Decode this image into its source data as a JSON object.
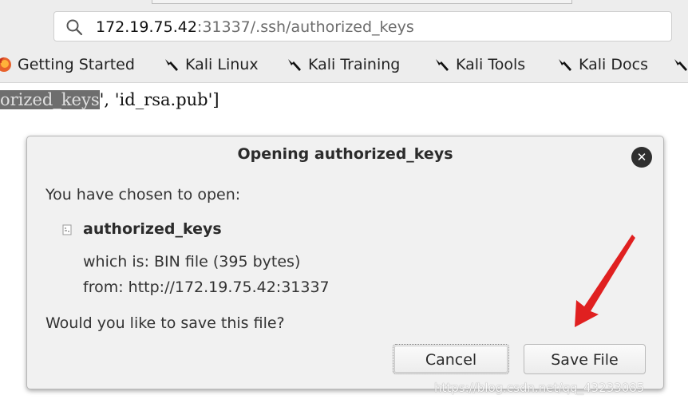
{
  "browser": {
    "url_host": "172.19.75.42",
    "url_rest": ":31337/.ssh/authorized_keys",
    "bookmarks": [
      {
        "label": "Getting Started",
        "icon": "firefox-icon"
      },
      {
        "label": "Kali Linux",
        "icon": "kali-dragon-icon"
      },
      {
        "label": "Kali Training",
        "icon": "kali-dragon-icon"
      },
      {
        "label": "Kali Tools",
        "icon": "kali-dragon-icon"
      },
      {
        "label": "Kali Docs",
        "icon": "kali-dragon-icon"
      }
    ]
  },
  "page": {
    "highlighted_text": "orized_keys",
    "rest_text": "', 'id_rsa.pub']"
  },
  "dialog": {
    "title": "Opening authorized_keys",
    "close_icon": "close-icon",
    "chosen_label": "You have chosen to open:",
    "file_name": "authorized_keys",
    "which_is_label": "which is:",
    "which_is_value": "BIN file (395 bytes)",
    "from_label": "from:",
    "from_value": "http://172.19.75.42:31337",
    "question": "Would you like to save this file?",
    "cancel_label": "Cancel",
    "save_label": "Save File"
  },
  "annotation": {
    "arrow_color": "#e02020"
  },
  "watermark": "https://blog.csdn.net/qq_43233085"
}
